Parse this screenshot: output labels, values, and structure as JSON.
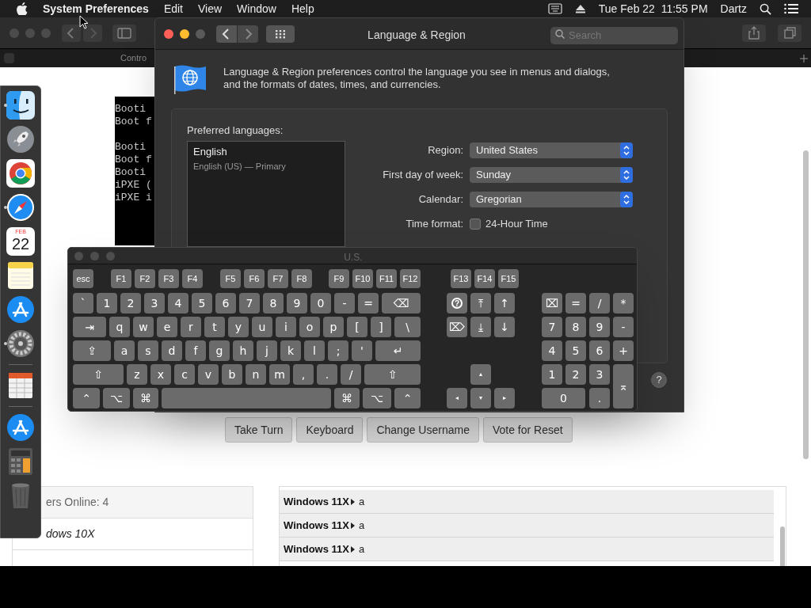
{
  "menu_bar": {
    "app_name": "System Preferences",
    "menus": [
      "Edit",
      "View",
      "Window",
      "Help"
    ],
    "clock": "Tue Feb 22  11:55 PM",
    "user": "Dartz"
  },
  "browser": {
    "tab_label": "Contro",
    "console_blocks": [
      [
        "Booti",
        "Boot f"
      ],
      [
        "Booti",
        "Boot f",
        "Booti",
        "iPXE (",
        "iPXE i"
      ]
    ],
    "buttons": [
      "Take Turn",
      "Keyboard",
      "Change Username",
      "Vote for Reset"
    ],
    "users_header": "ers Online: 4",
    "users": [
      "dows 10X"
    ],
    "chat": [
      {
        "user": "Windows 11X",
        "message": "a"
      },
      {
        "user": "Windows 11X",
        "message": "a"
      },
      {
        "user": "Windows 11X",
        "message": "a"
      }
    ]
  },
  "prefs": {
    "title": "Language & Region",
    "search_placeholder": "Search",
    "description": "Language & Region preferences control the language you see in menus and dialogs, and the formats of dates, times, and currencies.",
    "languages_label": "Preferred languages:",
    "languages": [
      {
        "name": "English",
        "detail": "English (US) — Primary"
      }
    ],
    "settings": [
      {
        "label": "Region:",
        "kind": "popup",
        "value": "United States"
      },
      {
        "label": "First day of week:",
        "kind": "popup",
        "value": "Sunday"
      },
      {
        "label": "Calendar:",
        "kind": "popup",
        "value": "Gregorian"
      },
      {
        "label": "Time format:",
        "kind": "checkbox",
        "value": "24-Hour Time",
        "checked": false
      }
    ],
    "help": "?"
  },
  "keyboard": {
    "title": "U.S.",
    "function_keys": [
      "esc",
      "F1",
      "F2",
      "F3",
      "F4",
      "F5",
      "F6",
      "F7",
      "F8",
      "F9",
      "F10",
      "F11",
      "F12",
      "F13",
      "F14",
      "F15"
    ],
    "main_rows": [
      [
        "`",
        "1",
        "2",
        "3",
        "4",
        "5",
        "6",
        "7",
        "8",
        "9",
        "0",
        "-",
        "=",
        "⌫"
      ],
      [
        "⇥",
        "q",
        "w",
        "e",
        "r",
        "t",
        "y",
        "u",
        "i",
        "o",
        "p",
        "[",
        "]",
        "\\"
      ],
      [
        "⇪",
        "a",
        "s",
        "d",
        "f",
        "g",
        "h",
        "j",
        "k",
        "l",
        ";",
        "'",
        "↵"
      ],
      [
        "⇧",
        "z",
        "x",
        "c",
        "v",
        "b",
        "n",
        "m",
        ",",
        ".",
        "/",
        "⇧"
      ],
      [
        "⌃",
        "⌥",
        "⌘",
        "⌘",
        "⌥",
        "⌃"
      ]
    ],
    "nav_rows": [
      [
        "?",
        "⤒",
        "↑"
      ],
      [
        "⌦",
        "⤓",
        "↓"
      ],
      [
        "▴"
      ],
      [
        "◂",
        "▾",
        "▸"
      ]
    ],
    "numpad_rows": [
      [
        "⌧",
        "=",
        "/",
        "*"
      ],
      [
        "7",
        "8",
        "9",
        "-"
      ],
      [
        "4",
        "5",
        "6",
        "+"
      ],
      [
        "1",
        "2",
        "3",
        "⌅"
      ],
      [
        "0",
        "."
      ]
    ]
  },
  "dock": [
    {
      "kind": "finder",
      "running": true
    },
    {
      "kind": "rocket",
      "running": false
    },
    {
      "kind": "chrome",
      "running": false
    },
    {
      "kind": "safari",
      "running": true
    },
    {
      "kind": "calendar",
      "running": false,
      "month": "FEB",
      "day": "22"
    },
    {
      "kind": "notes",
      "running": false
    },
    {
      "kind": "appstore",
      "running": false
    },
    {
      "kind": "gear",
      "running": true
    },
    {
      "kind": "separator"
    },
    {
      "kind": "sheet",
      "running": false
    },
    {
      "kind": "separator"
    },
    {
      "kind": "appstore",
      "running": false
    },
    {
      "kind": "calculator",
      "running": false
    },
    {
      "kind": "trash",
      "running": false
    }
  ]
}
